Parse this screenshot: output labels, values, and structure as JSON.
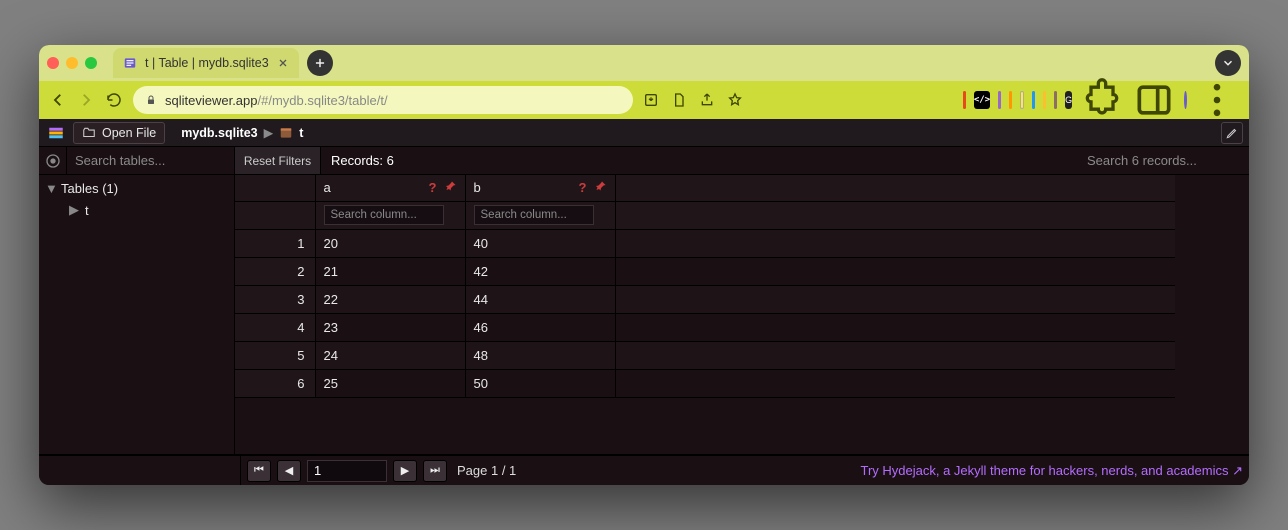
{
  "browser": {
    "tab_title": "t | Table | mydb.sqlite3",
    "url_host": "sqliteviewer.app",
    "url_path": "/#/mydb.sqlite3/table/t/"
  },
  "toolbar": {
    "open_file": "Open File",
    "db_name": "mydb.sqlite3",
    "table_name": "t"
  },
  "filters": {
    "search_tables_ph": "Search tables...",
    "reset": "Reset Filters",
    "records_label": "Records: 6",
    "search_records_ph": "Search 6 records...",
    "search_column_ph": "Search column..."
  },
  "sidebar": {
    "group": "Tables (1)",
    "items": [
      "t"
    ]
  },
  "table": {
    "columns": [
      "a",
      "b"
    ],
    "rows": [
      {
        "n": "1",
        "a": "20",
        "b": "40"
      },
      {
        "n": "2",
        "a": "21",
        "b": "42"
      },
      {
        "n": "3",
        "a": "22",
        "b": "44"
      },
      {
        "n": "4",
        "a": "23",
        "b": "46"
      },
      {
        "n": "5",
        "a": "24",
        "b": "48"
      },
      {
        "n": "6",
        "a": "25",
        "b": "50"
      }
    ]
  },
  "pager": {
    "page_value": "1",
    "page_label": "Page 1 / 1"
  },
  "promo": "Try Hydejack, a Jekyll theme for hackers, nerds, and academics ↗"
}
